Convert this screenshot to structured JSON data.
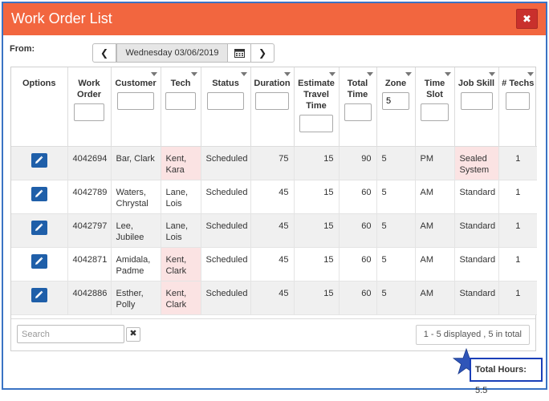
{
  "dialog": {
    "title": "Work Order List",
    "close_glyph": "✖"
  },
  "date_picker": {
    "label": "From:",
    "value": "Wednesday 03/06/2019",
    "prev_glyph": "❮",
    "next_glyph": "❯"
  },
  "columns": [
    {
      "label": "Options",
      "filter": false
    },
    {
      "label": "Work Order",
      "filter": true,
      "value": ""
    },
    {
      "label": "Customer",
      "filter": true,
      "value": ""
    },
    {
      "label": "Tech",
      "filter": true,
      "value": ""
    },
    {
      "label": "Status",
      "filter": true,
      "value": ""
    },
    {
      "label": "Duration",
      "filter": true,
      "value": ""
    },
    {
      "label": "Estimate Travel Time",
      "filter": true,
      "value": ""
    },
    {
      "label": "Total Time",
      "filter": true,
      "value": ""
    },
    {
      "label": "Zone",
      "filter": true,
      "value": "5"
    },
    {
      "label": "Time Slot",
      "filter": true,
      "value": ""
    },
    {
      "label": "Job Skill",
      "filter": true,
      "value": ""
    },
    {
      "label": "# Techs",
      "filter": true,
      "value": ""
    }
  ],
  "rows": [
    {
      "work_order": "4042694",
      "customer": "Bar, Clark",
      "tech": "Kent, Kara",
      "tech_highlight": true,
      "status": "Scheduled",
      "duration": "75",
      "travel": "15",
      "total": "90",
      "zone": "5",
      "slot": "PM",
      "skill": "Sealed System",
      "skill_highlight": true,
      "techs": "1"
    },
    {
      "work_order": "4042789",
      "customer": "Waters, Chrystal",
      "tech": "Lane, Lois",
      "tech_highlight": false,
      "status": "Scheduled",
      "duration": "45",
      "travel": "15",
      "total": "60",
      "zone": "5",
      "slot": "AM",
      "skill": "Standard",
      "skill_highlight": false,
      "techs": "1"
    },
    {
      "work_order": "4042797",
      "customer": "Lee, Jubilee",
      "tech": "Lane, Lois",
      "tech_highlight": false,
      "status": "Scheduled",
      "duration": "45",
      "travel": "15",
      "total": "60",
      "zone": "5",
      "slot": "AM",
      "skill": "Standard",
      "skill_highlight": false,
      "techs": "1"
    },
    {
      "work_order": "4042871",
      "customer": "Amidala, Padme",
      "tech": "Kent, Clark",
      "tech_highlight": true,
      "status": "Scheduled",
      "duration": "45",
      "travel": "15",
      "total": "60",
      "zone": "5",
      "slot": "AM",
      "skill": "Standard",
      "skill_highlight": false,
      "techs": "1"
    },
    {
      "work_order": "4042886",
      "customer": "Esther, Polly",
      "tech": "Kent, Clark",
      "tech_highlight": true,
      "status": "Scheduled",
      "duration": "45",
      "travel": "15",
      "total": "60",
      "zone": "5",
      "slot": "AM",
      "skill": "Standard",
      "skill_highlight": false,
      "techs": "1"
    }
  ],
  "footer": {
    "search_placeholder": "Search",
    "clear_glyph": "✖",
    "paging": "1 - 5 displayed , 5 in total"
  },
  "summary": {
    "total_label": "Total Hours:",
    "total_value": "5.5"
  },
  "colors": {
    "header": "#f2663f",
    "close": "#c9302c",
    "edit": "#1f5fa9",
    "highlight": "#fbe3e3",
    "summary_border": "#1a3fb8",
    "star": "#2f55b8"
  },
  "icons": {
    "edit": "pencil-icon",
    "calendar": "calendar-icon",
    "star": "star-icon"
  }
}
